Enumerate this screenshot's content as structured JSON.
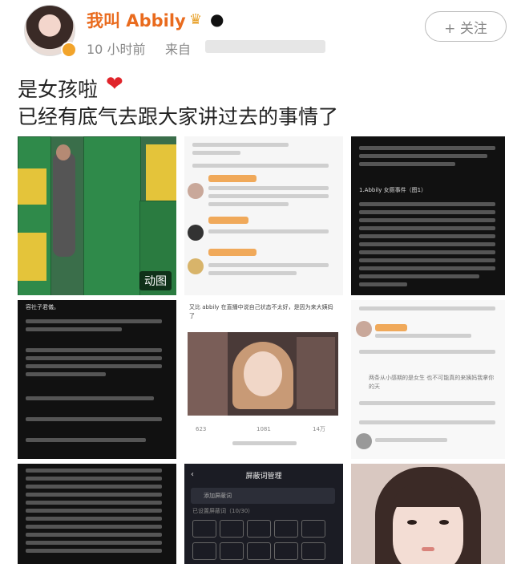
{
  "header": {
    "username": "我叫 Abbily",
    "time": "10 小时前",
    "from_label": "来自",
    "follow_label": "+ 关注"
  },
  "post": {
    "line1": "是女孩啦",
    "line2": "已经有底气去跟大家讲过去的事情了"
  },
  "images": {
    "gif_badge": "动图",
    "cell3_text": "1.Abbily 女厕事件（图1）",
    "cell4_title": "容社子君儀。",
    "cell5_text": "又比 abbily 在直播中说自己状态不太好，是因为来大姨妈了",
    "cell5_footer_1": "623",
    "cell5_footer_2": "1081",
    "cell5_footer_3": "14万",
    "cell6_text": "两条从小感期的是女生 也不可能真的来姨妈我拿你的天",
    "cell8_title": "屏蔽词管理",
    "cell8_input": "添加屏蔽词",
    "cell8_count": "已设置屏蔽词（10/30）"
  },
  "colors": {
    "username": "#e96b1e",
    "heart": "#e0242a"
  }
}
